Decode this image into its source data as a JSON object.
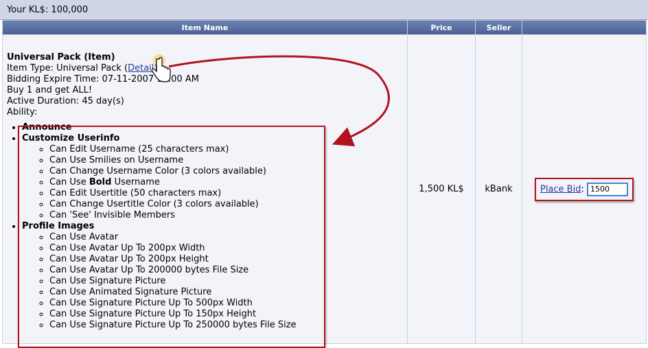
{
  "balance": {
    "label": "Your KL$: 100,000"
  },
  "table": {
    "headers": {
      "item": "Item Name",
      "price": "Price",
      "seller": "Seller",
      "bid": ""
    }
  },
  "item": {
    "title": "Universal Pack (Item)",
    "type_prefix": "Item Type: Universal Pack (",
    "detail_link": "Detail",
    "type_suffix": ")",
    "expire": "Bidding Expire Time: 07-11-2007 12:00 AM",
    "description": "Buy 1 and get ALL!",
    "duration": "Active Duration: 45 day(s)",
    "ability_label": "Ability:",
    "abilities": {
      "announce": "Announce",
      "customize": {
        "title": "Customize Userinfo",
        "items": [
          "Can Edit Username (25 characters max)",
          "Can Use Smilies on Username",
          "Can Change Username Color (3 colors available)"
        ],
        "bold_pre": "Can Use ",
        "bold_word": "Bold",
        "bold_post": " Username",
        "items2": [
          "Can Edit Usertitle (50 characters max)",
          "Can Change Usertitle Color (3 colors available)",
          "Can 'See' Invisible Members"
        ]
      },
      "profile": {
        "title": "Profile Images",
        "items": [
          "Can Use Avatar",
          "Can Use Avatar Up To 200px Width",
          "Can Use Avatar Up To 200px Height",
          "Can Use Avatar Up To 200000 bytes File Size",
          "Can Use Signature Picture",
          "Can Use Animated Signature Picture",
          "Can Use Signature Picture Up To 500px Width",
          "Can Use Signature Picture Up To 150px Height",
          "Can Use Signature Picture Up To 250000 bytes File Size"
        ]
      }
    },
    "price": "1,500 KL$",
    "seller": "kBank"
  },
  "bid": {
    "link": "Place Bid",
    "colon": ":",
    "value": "1500"
  },
  "colors": {
    "header_bg": "#4a5f93",
    "highlight": "#b0141e",
    "link": "#2a3a9c"
  },
  "icons": {
    "cursor": "hand-pointer-icon",
    "arrow": "curved-arrow"
  }
}
